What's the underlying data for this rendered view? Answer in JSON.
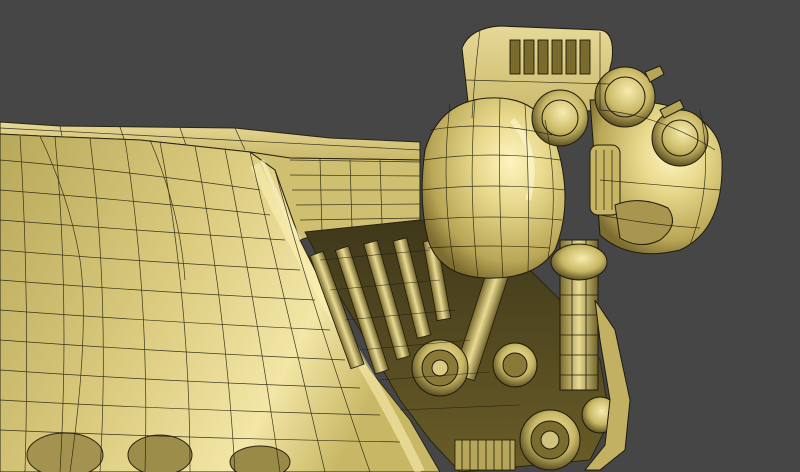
{
  "viewport": {
    "background_color": "#464646"
  },
  "model": {
    "shading": "wireframe-on-shaded",
    "surface_color": "#d8c878",
    "highlight_color": "#fff6c0",
    "shadow_color": "#5a4f22",
    "wire_color": "#1c1a0e"
  }
}
